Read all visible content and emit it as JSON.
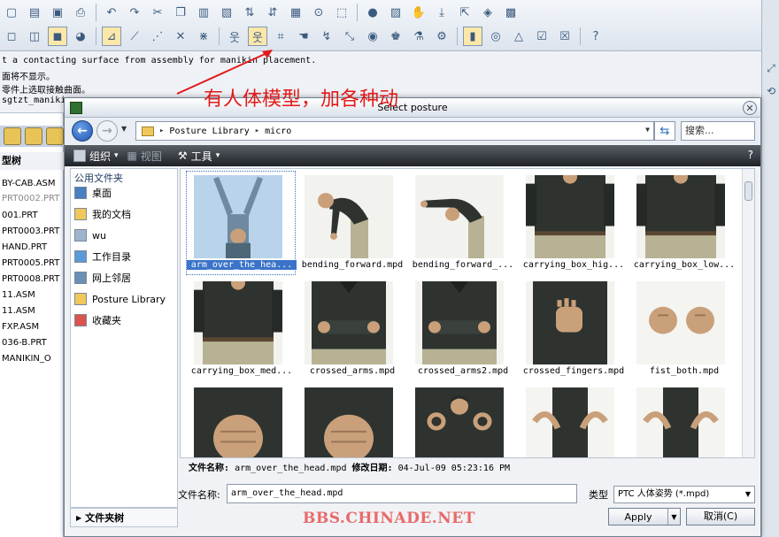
{
  "app": {
    "messages": [
      "t a contacting surface from assembly for manikin placement.",
      "面将不显示。",
      "零件上选取接触曲面。",
      "sgtzt_manikin"
    ],
    "tree": {
      "title": "型树",
      "items": [
        "BY-CAB.ASM",
        "PRT0002.PRT",
        "001.PRT",
        "PRT0003.PRT",
        "HAND.PRT",
        "PRT0005.PRT",
        "PRT0008.PRT",
        "11.ASM",
        "11.ASM",
        "FXP.ASM",
        "036-B.PRT",
        "MANIKIN_O"
      ]
    }
  },
  "annotation": "有人体模型，加各种动",
  "watermark": "BBS.CHINADE.NET",
  "dialog": {
    "title": "Select posture",
    "address": [
      "Posture Library",
      "micro"
    ],
    "search_placeholder": "搜索...",
    "toolbar": {
      "organize": "组织",
      "views": "视图",
      "tools": "工具"
    },
    "nav": {
      "header": "公用文件夹",
      "items": [
        {
          "label": "桌面",
          "icon": "desktop-icon",
          "color": "#4a7fc0"
        },
        {
          "label": "我的文档",
          "icon": "documents-icon",
          "color": "#f0c85a"
        },
        {
          "label": "wu",
          "icon": "user-folder-icon",
          "color": "#9fb4cc"
        },
        {
          "label": "工作目录",
          "icon": "working-directory-icon",
          "color": "#5a9ad8"
        },
        {
          "label": "网上邻居",
          "icon": "network-icon",
          "color": "#6c8fb6"
        },
        {
          "label": "Posture Library",
          "icon": "library-folder-icon",
          "color": "#f0c85a"
        },
        {
          "label": "收藏夹",
          "icon": "favorites-icon",
          "color": "#d9534f"
        }
      ],
      "folder_tree": "文件夹树"
    },
    "files": [
      {
        "name": "arm_over_the_hea...",
        "pose": "arms-up"
      },
      {
        "name": "bending_forward.mpd",
        "pose": "bend"
      },
      {
        "name": "bending_forward_...",
        "pose": "bend-reach"
      },
      {
        "name": "carrying_box_hig...",
        "pose": "torso"
      },
      {
        "name": "carrying_box_low...",
        "pose": "torso"
      },
      {
        "name": "carrying_box_med...",
        "pose": "torso"
      },
      {
        "name": "crossed_arms.mpd",
        "pose": "crossed"
      },
      {
        "name": "crossed_arms2.mpd",
        "pose": "crossed"
      },
      {
        "name": "crossed_fingers.mpd",
        "pose": "fingers"
      },
      {
        "name": "fist_both.mpd",
        "pose": "fists"
      },
      {
        "name": "",
        "pose": "fist-close"
      },
      {
        "name": "",
        "pose": "fist-close"
      },
      {
        "name": "",
        "pose": "ok-hands"
      },
      {
        "name": "",
        "pose": "hands-side"
      },
      {
        "name": "",
        "pose": "hands-side"
      }
    ],
    "selected_index": 0,
    "info": {
      "name_label": "文件名称:",
      "name_value": "arm_over_the_head.mpd",
      "date_label": "修改日期:",
      "date_value": "04-Jul-09 05:23:16 PM"
    },
    "filename_label": "文件名称:",
    "filename_value": "arm_over_the_head.mpd",
    "type_label": "类型",
    "type_value": "PTC 人体姿势 (*.mpd)",
    "apply": "Apply",
    "cancel": "取消(C)"
  },
  "colors": {
    "shirt": "#2e332f",
    "skin": "#c9a07a",
    "pants": "#b8b294",
    "selection": "#3a73c9"
  }
}
